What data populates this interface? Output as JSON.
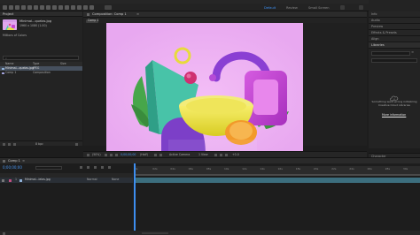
{
  "app": {
    "accent": "#3d8ef0"
  },
  "workspaces": [
    {
      "label": "Default",
      "active": true
    },
    {
      "label": "Review",
      "active": false
    },
    {
      "label": "Small Screen",
      "active": false
    }
  ],
  "project": {
    "tab": "Project",
    "item_name": "Minimal...quelas.jpg",
    "item_dims": "1960 x 1080 (1.00)",
    "item_sub": "Millions of Colors",
    "search_placeholder": "",
    "columns": {
      "name": "Name",
      "type": "Type",
      "size": "Size"
    },
    "rows": [
      {
        "name": "Minimal...quelas.jpg",
        "type": "JPEG",
        "size": "",
        "selected": true
      },
      {
        "name": "Comp 1",
        "type": "Composition",
        "size": "",
        "selected": false
      }
    ],
    "footer_bpc": "8 bpc"
  },
  "composition": {
    "tab_label": "Composition: Comp 1",
    "breadcrumb": "Comp 1",
    "footer": {
      "zoom": "(50%)",
      "timecode": "0;00;00;00",
      "resolution": "(Half)",
      "camera": "Active Camera",
      "view": "1 View",
      "offset": "+0.0"
    }
  },
  "right_panels": [
    {
      "label": "Info"
    },
    {
      "label": "Audio"
    },
    {
      "label": "Preview"
    },
    {
      "label": "Effects & Presets"
    },
    {
      "label": "Align"
    },
    {
      "label": "Libraries"
    }
  ],
  "libraries": {
    "message": "Something went wrong initializing Creative Cloud Libraries",
    "more_info": "More information"
  },
  "character_panel": "Character",
  "timeline": {
    "tab": "Comp 1",
    "timecode": "0;00;00;00",
    "ruler_ticks": [
      "0s",
      "02s",
      "04s",
      "06s",
      "08s",
      "10s",
      "12s",
      "14s",
      "16s",
      "18s",
      "20s",
      "22s",
      "24s",
      "26s",
      "28s",
      "30s"
    ],
    "layer_number": "1",
    "layer_name": "Minimal...lelas.jpg",
    "mode": "Normal",
    "parent": "None"
  }
}
